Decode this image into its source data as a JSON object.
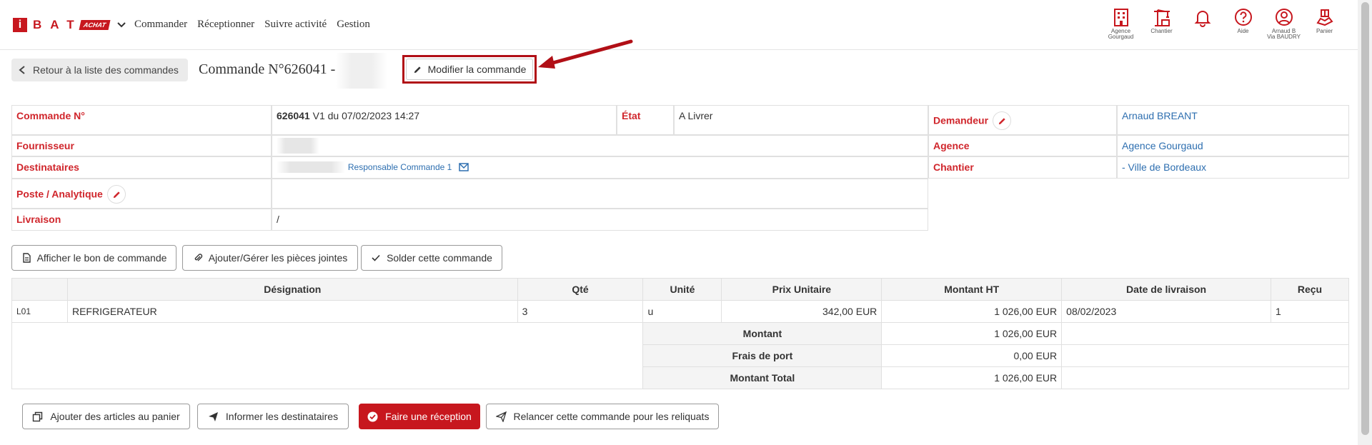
{
  "brand": {
    "letter": "i",
    "name": "BAT",
    "badge": "ACHAT"
  },
  "nav": [
    "Commander",
    "Réceptionner",
    "Suivre activité",
    "Gestion"
  ],
  "topicons": [
    {
      "icon": "building-icon",
      "label": "Agence\nGourgaud"
    },
    {
      "icon": "crane-icon",
      "label": "Chantier"
    },
    {
      "icon": "bell-icon",
      "label": ""
    },
    {
      "icon": "help-icon",
      "label": "Aide"
    },
    {
      "icon": "user-icon",
      "label": "Arnaud B\nVia BAUDRY"
    },
    {
      "icon": "cart-icon",
      "label": "Panier"
    }
  ],
  "header": {
    "back_label": "Retour à la liste des commandes",
    "title": "Commande N°626041 -",
    "modify_label": "Modifier la commande"
  },
  "info": {
    "order_label": "Commande N°",
    "order_number": "626041",
    "order_version": " V1 du 07/02/2023 14:27",
    "state_label": "État",
    "state_value": "A Livrer",
    "requester_label": "Demandeur",
    "requester_value": "Arnaud BREANT",
    "supplier_label": "Fournisseur",
    "agency_label": "Agence",
    "agency_value": "Agence Gourgaud",
    "recipients_label": "Destinataires",
    "recipients_role": "Responsable Commande 1",
    "site_label": "Chantier",
    "site_value": "- Ville de Bordeaux",
    "post_label": "Poste / Analytique",
    "delivery_label": "Livraison",
    "delivery_value": "/"
  },
  "actions": [
    "Afficher le bon de commande",
    "Ajouter/Gérer les pièces jointes",
    "Solder cette commande"
  ],
  "table": {
    "headers": [
      "",
      "Désignation",
      "Qté",
      "Unité",
      "Prix Unitaire",
      "Montant HT",
      "Date de livraison",
      "Reçu"
    ],
    "rows": [
      {
        "ref": "L01",
        "designation": "REFRIGERATEUR",
        "qty": "3",
        "unit": "u",
        "unit_price": "342,00 EUR",
        "amount": "1 026,00 EUR",
        "date": "08/02/2023",
        "received": "1"
      }
    ],
    "totals": [
      {
        "label": "Montant",
        "value": "1 026,00 EUR"
      },
      {
        "label": "Frais de port",
        "value": "0,00 EUR"
      },
      {
        "label": "Montant Total",
        "value": "1 026,00 EUR"
      }
    ]
  },
  "bottom": [
    "Ajouter des articles au panier",
    "Informer les destinataires",
    "Faire une réception",
    "Relancer cette commande pour les reliquats"
  ],
  "colors": {
    "brand": "#c7171e",
    "link": "#2e6fb0",
    "label": "#d0262c"
  }
}
